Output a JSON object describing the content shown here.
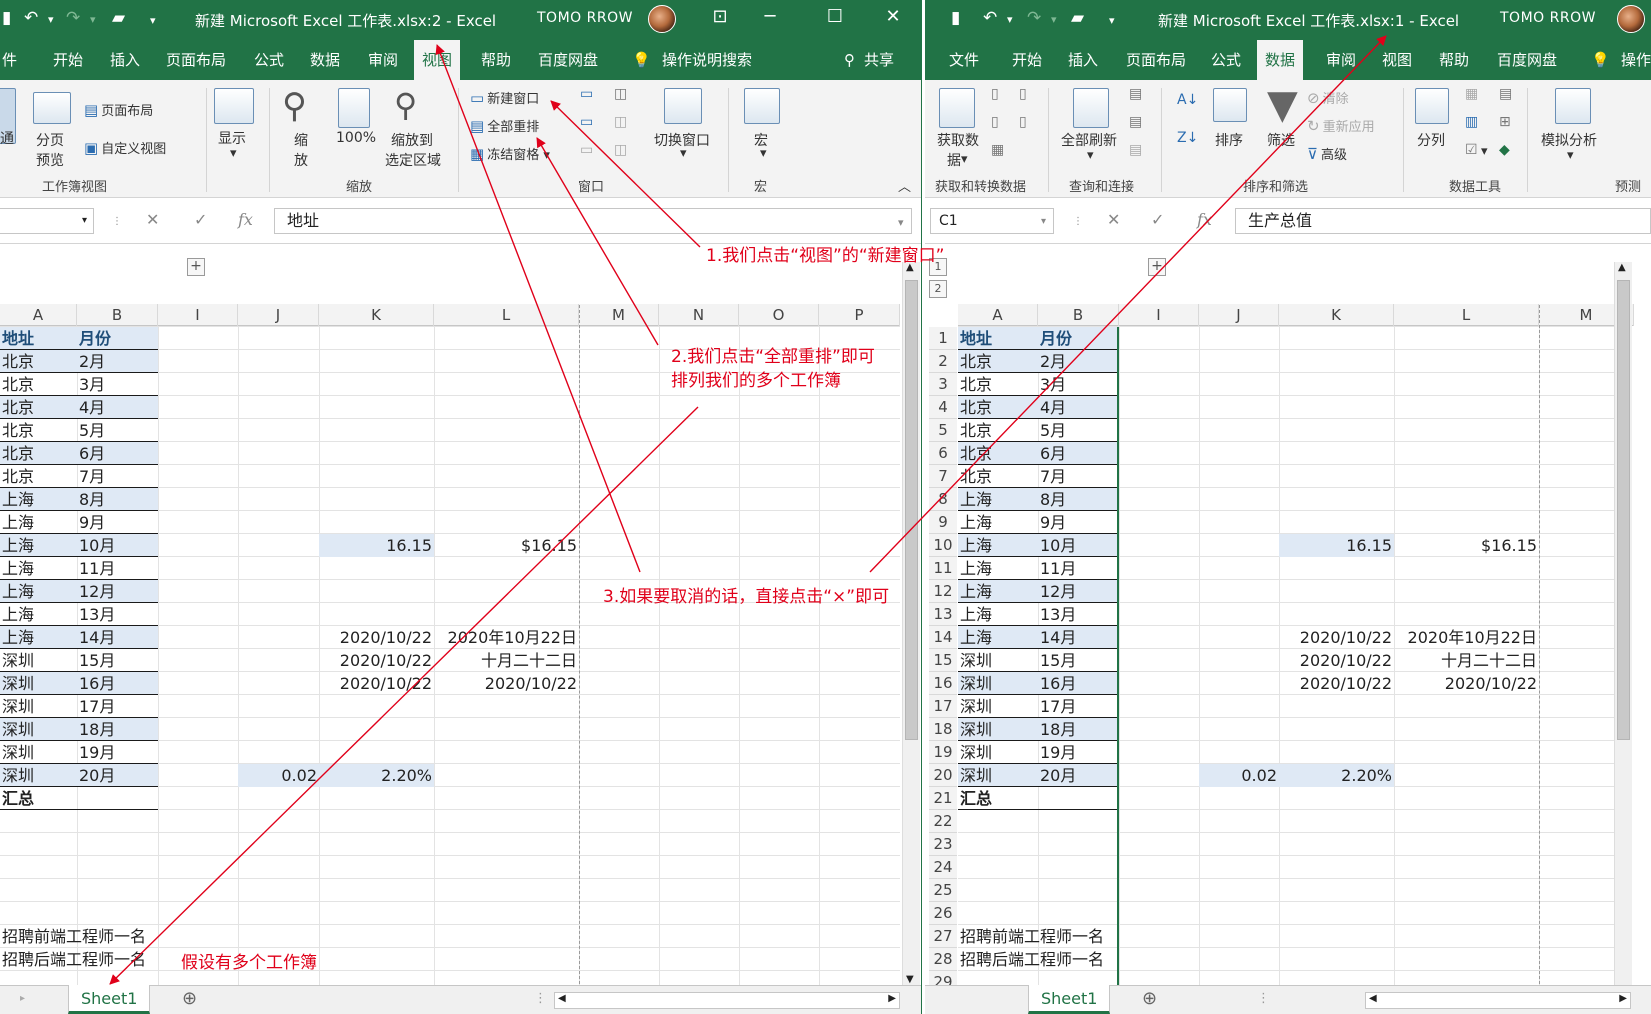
{
  "left": {
    "title": "新建 Microsoft Excel 工作表.xlsx:2  -  Excel",
    "user": "TOMO RROW",
    "tabs": [
      "件",
      "开始",
      "插入",
      "页面布局",
      "公式",
      "数据",
      "审阅",
      "视图",
      "帮助",
      "百度网盘",
      "操作说明搜索",
      "共享"
    ],
    "active_tab": "视图",
    "ribbon": {
      "workbook_view": {
        "normal": "通",
        "page_break_1": "分页",
        "page_break_2": "预览",
        "page_layout": "页面布局",
        "custom_view": "自定义视图",
        "group": "工作簿视图"
      },
      "show": {
        "label": "显示"
      },
      "zoom": {
        "zoom_1": "缩",
        "zoom_2": "放",
        "hundred": "100%",
        "to_sel_1": "缩放到",
        "to_sel_2": "选定区域",
        "group": "缩放"
      },
      "window": {
        "new_window": "新建窗口",
        "arrange_all": "全部重排",
        "freeze": "冻结窗格",
        "switch": "切换窗口",
        "group": "窗口"
      },
      "macros": {
        "label": "宏",
        "group": "宏"
      }
    },
    "formula_value": "地址",
    "col_headers": [
      "A",
      "B",
      "I",
      "J",
      "K",
      "L",
      "M",
      "N",
      "O",
      "P"
    ],
    "sheet_tab": "Sheet1"
  },
  "right": {
    "title": "新建 Microsoft Excel 工作表.xlsx:1  -  Excel",
    "user": "TOMO RROW",
    "tabs": [
      "文件",
      "开始",
      "插入",
      "页面布局",
      "公式",
      "数据",
      "审阅",
      "视图",
      "帮助",
      "百度网盘",
      "操作"
    ],
    "active_tab": "数据",
    "ribbon": {
      "get_data_1": "获取数",
      "get_data_2": "据",
      "get_group": "获取和转换数据",
      "refresh_all": "全部刷新",
      "query_group": "查询和连接",
      "sort": "排序",
      "filter": "筛选",
      "clear": "清除",
      "reapply": "重新应用",
      "advanced": "高级",
      "sort_group": "排序和筛选",
      "split": "分列",
      "tools_group": "数据工具",
      "whatif": "模拟分析",
      "forecast_group": "预测"
    },
    "name_box": "C1",
    "formula_value": "生产总值",
    "col_headers": [
      "A",
      "B",
      "I",
      "J",
      "K",
      "L",
      "M"
    ],
    "outline": [
      "1",
      "2"
    ],
    "sheet_tab": "Sheet1"
  },
  "sheet": {
    "rows": [
      {
        "a": "地址",
        "b": "月份",
        "hdr": true
      },
      {
        "a": "北京",
        "b": "2月"
      },
      {
        "a": "北京",
        "b": "3月"
      },
      {
        "a": "北京",
        "b": "4月"
      },
      {
        "a": "北京",
        "b": "5月"
      },
      {
        "a": "北京",
        "b": "6月"
      },
      {
        "a": "北京",
        "b": "7月"
      },
      {
        "a": "上海",
        "b": "8月"
      },
      {
        "a": "上海",
        "b": "9月"
      },
      {
        "a": "上海",
        "b": "10月",
        "k": "16.15",
        "l": "$16.15"
      },
      {
        "a": "上海",
        "b": "11月"
      },
      {
        "a": "上海",
        "b": "12月"
      },
      {
        "a": "上海",
        "b": "13月"
      },
      {
        "a": "上海",
        "b": "14月",
        "k": "2020/10/22",
        "l": "2020年10月22日"
      },
      {
        "a": "深圳",
        "b": "15月",
        "k": "2020/10/22",
        "l": "十月二十二日"
      },
      {
        "a": "深圳",
        "b": "16月",
        "k": "2020/10/22",
        "l": "2020/10/22"
      },
      {
        "a": "深圳",
        "b": "17月"
      },
      {
        "a": "深圳",
        "b": "18月"
      },
      {
        "a": "深圳",
        "b": "19月"
      },
      {
        "a": "深圳",
        "b": "20月",
        "j": "0.02",
        "k": "2.20%"
      },
      {
        "a": "汇总",
        "b": "",
        "total": true
      },
      {
        "a": "",
        "b": ""
      },
      {
        "a": "",
        "b": ""
      },
      {
        "a": "",
        "b": ""
      },
      {
        "a": "",
        "b": ""
      },
      {
        "a": "",
        "b": ""
      },
      {
        "a": "招聘前端工程师一名",
        "b": ""
      },
      {
        "a": "招聘后端工程师一名",
        "b": ""
      }
    ],
    "row_numbers": [
      "1",
      "2",
      "3",
      "4",
      "5",
      "6",
      "7",
      "8",
      "9",
      "10",
      "11",
      "12",
      "13",
      "14",
      "15",
      "16",
      "17",
      "18",
      "19",
      "20",
      "21",
      "22",
      "23",
      "24",
      "25",
      "26",
      "27",
      "28",
      "29"
    ]
  },
  "annotations": {
    "a1": "1.我们点击“视图”的“新建窗口”",
    "a2_1": "2.我们点击“全部重排”即可",
    "a2_2": "排列我们的多个工作簿",
    "a3": "3.如果要取消的话，直接点击“×”即可",
    "a4": "假设有多个工作簿"
  },
  "colors": {
    "excel_green": "#217346",
    "annotation_red": "#e0001a",
    "header_fill": "#dfe9f5"
  }
}
